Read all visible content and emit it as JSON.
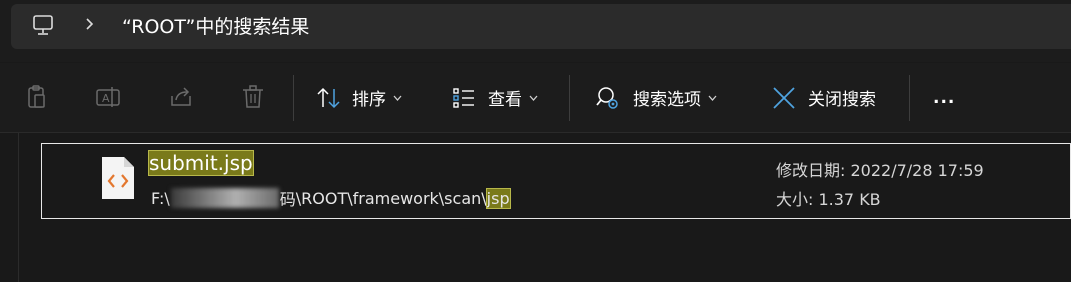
{
  "address": {
    "title": "“ROOT”中的搜索结果",
    "icons": [
      "computer-icon",
      "chevron-right-icon"
    ]
  },
  "toolbar": {
    "disabled_icons": [
      "paste-icon",
      "rename-icon",
      "share-icon",
      "delete-icon"
    ],
    "sort_label": "排序",
    "view_label": "查看",
    "search_options_label": "搜索选项",
    "close_search_label": "关闭搜索",
    "more_label": "..."
  },
  "result": {
    "name_highlight": "submit.jsp",
    "name_rest": "",
    "path_prefix": "F:\\",
    "path_obscured_tail": "码",
    "path_mid": "\\ROOT\\framework\\scan\\",
    "path_highlight": "jsp",
    "modified_label": "修改日期: 2022/7/28 17:59",
    "size_label": "大小: 1.37 KB"
  },
  "colors": {
    "background": "#191919",
    "highlight": "#7a7a1a",
    "accent_blue": "#4fa3e0",
    "file_icon_orange": "#e3772e"
  }
}
